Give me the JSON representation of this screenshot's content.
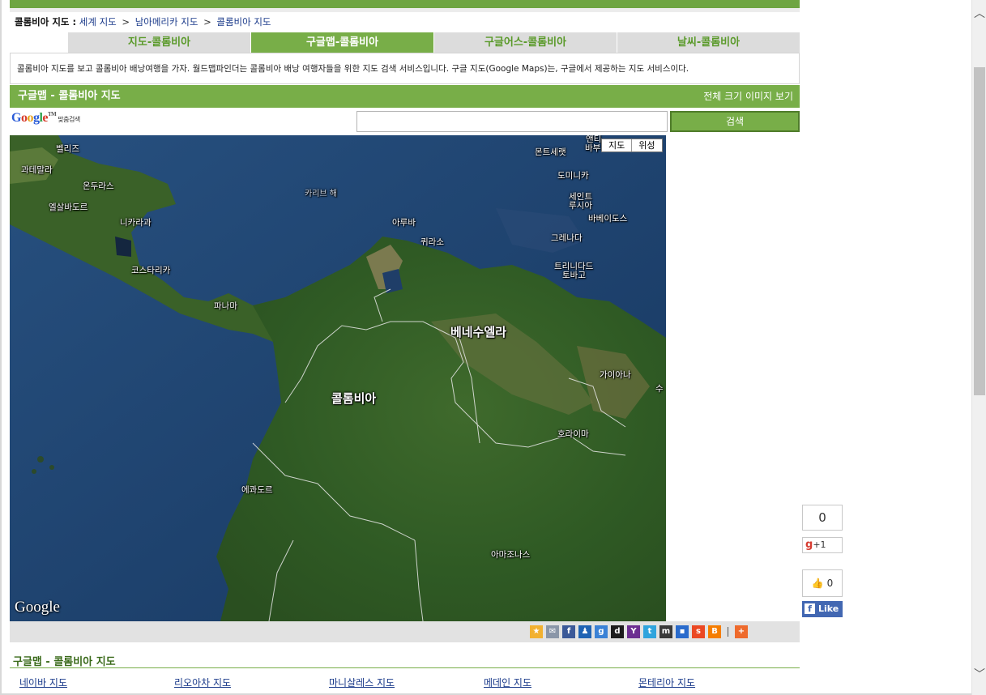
{
  "breadcrumb": {
    "title": "콜롬비아 지도 :",
    "world": "세계 지도",
    "continent": "남아메리카 지도",
    "current": "콜롬비아 지도",
    "sep": ">"
  },
  "tabs": [
    {
      "label": "지도-콜롬비아",
      "active": false
    },
    {
      "label": "구글맵-콜롬비아",
      "active": true
    },
    {
      "label": "구글어스-콜롬비아",
      "active": false
    },
    {
      "label": "날씨-콜롬비아",
      "active": false
    }
  ],
  "description": "콜롬비아 지도를 보고 콜롬비아 배낭여행을 가자. 월드맵파인더는 콜롬비아 배낭 여행자들을 위한 지도 검색 서비스입니다.  구글 지도(Google Maps)는, 구글에서 제공하는 지도 서비스이다.",
  "section": {
    "title": "구글맵 - 콜롬비아 지도",
    "fullsize_link": "전체 크기 이미지 보기"
  },
  "search": {
    "logo_text": "Google",
    "logo_tm": "TM",
    "logo_sub": "맞춤검색",
    "value": "",
    "button": "검색"
  },
  "map": {
    "type_map": "지도",
    "type_satellite": "위성",
    "attribution": "Google",
    "labels": {
      "belize": "벨리즈",
      "guatemala": "과테말라",
      "honduras": "온두라스",
      "el_salvador": "엘살바도르",
      "nicaragua": "니카라과",
      "costa_rica": "코스타리카",
      "panama": "파나마",
      "caribbean": "카리브 해",
      "aruba": "아루바",
      "curacao": "퀴라소",
      "montserrat": "몬트세랫",
      "antigua": "앤티",
      "barbuda": "바부",
      "dominica": "도미니카",
      "saint": "세인트",
      "lucia": "루시아",
      "barbados": "바베이도스",
      "grenada": "그레나다",
      "trinidad": "트리니다드",
      "tobago": "토바고",
      "venezuela": "베네수엘라",
      "colombia": "콜롬비아",
      "guyana": "가이아나",
      "suriname": "수",
      "roraima": "호라이마",
      "ecuador": "에콰도르",
      "amazonas": "아마조나스"
    }
  },
  "share": {
    "icons": [
      {
        "name": "bookmark-star-icon",
        "glyph": "★",
        "color": "#f2b130"
      },
      {
        "name": "email-icon",
        "glyph": "✉",
        "color": "#8a96a8"
      },
      {
        "name": "facebook-share-icon",
        "glyph": "f",
        "color": "#3b5998"
      },
      {
        "name": "myspace-icon",
        "glyph": "♟",
        "color": "#1f63b4"
      },
      {
        "name": "google-share-icon",
        "glyph": "g",
        "color": "#3b82d6"
      },
      {
        "name": "digg-icon",
        "glyph": "d",
        "color": "#1c1c1c"
      },
      {
        "name": "yahoo-icon",
        "glyph": "Y",
        "color": "#6c2e91"
      },
      {
        "name": "twitter-icon",
        "glyph": "t",
        "color": "#2fa4dd"
      },
      {
        "name": "myyahoo-icon",
        "glyph": "m",
        "color": "#3a3a3a"
      },
      {
        "name": "delicious-icon",
        "glyph": "▪",
        "color": "#2a6bcc"
      },
      {
        "name": "stumbleupon-icon",
        "glyph": "s",
        "color": "#eb4823"
      },
      {
        "name": "blogger-icon",
        "glyph": "B",
        "color": "#f57d00"
      }
    ],
    "more_glyph": "+",
    "more_color": "#ee6a2c"
  },
  "social": {
    "gplus_count": "0",
    "gplus_label": "+1",
    "gplus_g": "g",
    "like_count": "0",
    "like_label": "Like",
    "like_f": "f"
  },
  "links": {
    "title": "구글맵 - 콜롬비아 지도",
    "items": [
      "네이바 지도",
      "리오아차 지도",
      "마니살레스 지도",
      "메데인 지도",
      "몬테리아 지도"
    ]
  },
  "scrollbar": {
    "up": "︿",
    "down": "﹀"
  }
}
